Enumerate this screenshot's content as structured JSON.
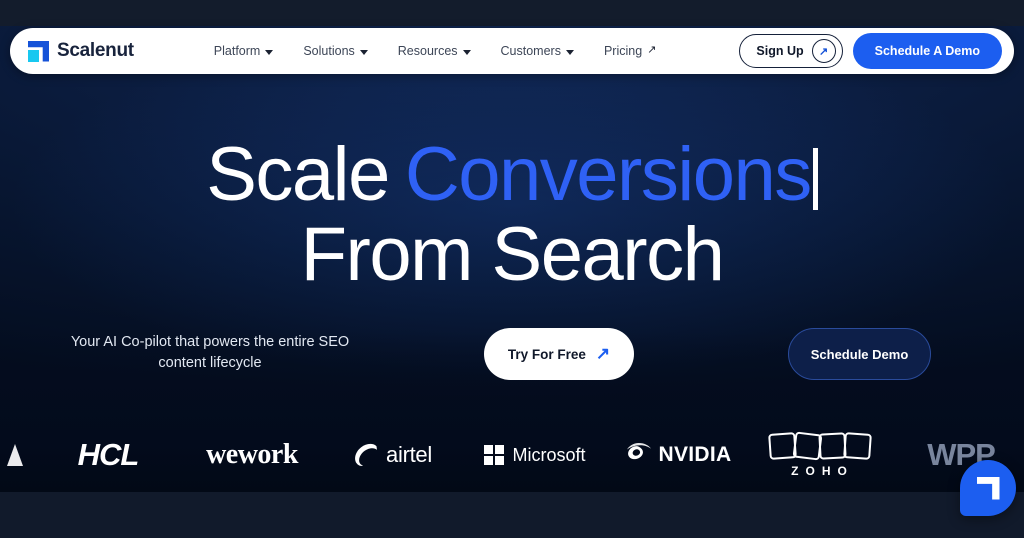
{
  "brand": {
    "name": "Scalenut",
    "logo_icon": "scalenut-mark-icon"
  },
  "nav": {
    "items": [
      {
        "label": "Platform",
        "indicator": "chevron-down-icon"
      },
      {
        "label": "Solutions",
        "indicator": "chevron-down-icon"
      },
      {
        "label": "Resources",
        "indicator": "chevron-down-icon"
      },
      {
        "label": "Customers",
        "indicator": "chevron-down-icon"
      },
      {
        "label": "Pricing",
        "indicator": "arrow-up-right-icon"
      }
    ],
    "sign_up_label": "Sign Up",
    "sign_up_icon": "arrow-up-right-icon",
    "demo_label": "Schedule A Demo"
  },
  "hero": {
    "line1_static": "Scale",
    "line1_accent": "Conversions",
    "line2": "From Search",
    "typing_caret": "|",
    "subcopy": "Your AI Co-pilot that powers the entire SEO content lifecycle",
    "primary_cta": "Try For Free",
    "primary_cta_icon": "arrow-up-right-icon",
    "secondary_cta": "Schedule Demo"
  },
  "logos": {
    "items": [
      {
        "name": "HCL"
      },
      {
        "name": "wework"
      },
      {
        "name": "airtel"
      },
      {
        "name": "Microsoft"
      },
      {
        "name": "NVIDIA"
      },
      {
        "name": "ZOHO"
      },
      {
        "name": "WPP"
      }
    ]
  },
  "chat": {
    "icon": "scalenut-chat-bubble-icon"
  },
  "colors": {
    "brand_blue": "#1c5ef0",
    "accent_blue": "#2f61f5",
    "cyan": "#18c8f0",
    "hero_bg": "#0b1c3e",
    "dark_bg": "#040d1f",
    "navbar_bg": "#ffffff"
  }
}
